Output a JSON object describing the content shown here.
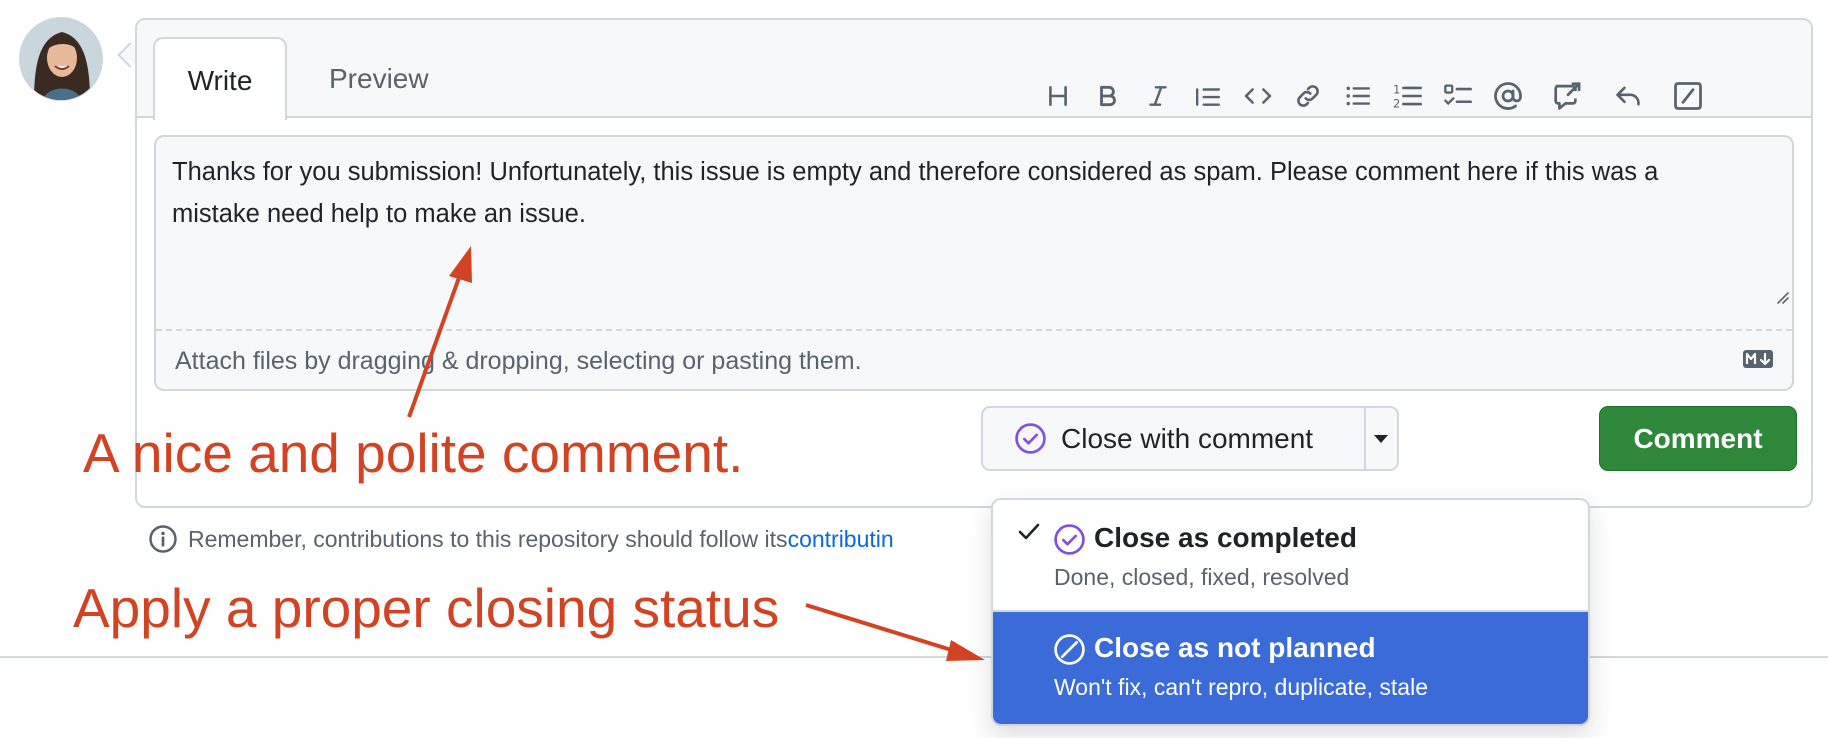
{
  "editor": {
    "tabs": {
      "write": "Write",
      "preview": "Preview"
    },
    "toolbar_icons": [
      "heading-icon",
      "bold-icon",
      "italic-icon",
      "quote-icon",
      "code-icon",
      "link-icon",
      "bullet-list-icon",
      "numbered-list-icon",
      "task-list-icon",
      "mention-icon",
      "cross-reference-icon",
      "reply-icon",
      "slash-command-icon"
    ],
    "text": "Thanks for you submission! Unfortunately, this issue is empty and therefore considered as spam. Please comment here if this was a mistake need help to make an issue.",
    "attach_hint": "Attach files by dragging & dropping, selecting or pasting them."
  },
  "actions": {
    "close_with_comment": "Close with comment",
    "comment": "Comment",
    "comment_color": "#2f883a"
  },
  "footer": {
    "text": "Remember, contributions to this repository should follow its ",
    "link": "contributin"
  },
  "menu": {
    "items": [
      {
        "title": "Close as completed",
        "description": "Done, closed, fixed, resolved",
        "selected": true,
        "icon": "check-circle-icon"
      },
      {
        "title": "Close as not planned",
        "description": "Won't fix, can't repro, duplicate, stale",
        "highlighted": true,
        "icon": "skip-icon"
      }
    ],
    "highlight_color": "#3a6bd8"
  },
  "annotations": {
    "comment_note": "A nice and polite comment.",
    "status_note": "Apply a proper closing status",
    "color": "#d24323"
  }
}
